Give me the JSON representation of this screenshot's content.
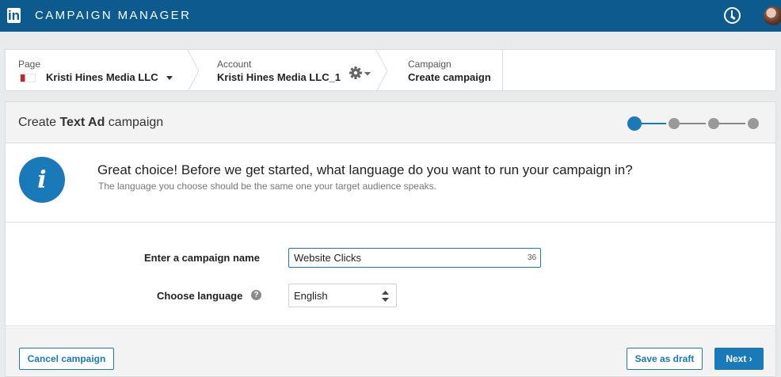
{
  "topbar": {
    "logo_text": "in",
    "app_title": "CAMPAIGN MANAGER",
    "icons": [
      "linkedin-logo",
      "clock-icon",
      "avatar"
    ]
  },
  "breadcrumb": {
    "page": {
      "label": "Page",
      "value": "Kristi Hines Media LLC"
    },
    "account": {
      "label": "Account",
      "value": "Kristi Hines Media LLC_1"
    },
    "campaign": {
      "label": "Campaign",
      "value": "Create campaign"
    }
  },
  "card": {
    "title_prefix": "Create ",
    "title_bold": "Text Ad",
    "title_suffix": " campaign",
    "stepper": {
      "total_steps": 4,
      "current_step": 1
    }
  },
  "info": {
    "icon_glyph": "i",
    "heading": "Great choice! Before we get started, what language do you want to run your campaign in?",
    "subtext": "The language you choose should be the same one your target audience speaks."
  },
  "form": {
    "name_label": "Enter a campaign name",
    "name_value": "Website Clicks",
    "name_remaining": "36",
    "language_label": "Choose language",
    "help_glyph": "?",
    "language_value": "English"
  },
  "footer": {
    "cancel_label": "Cancel campaign",
    "draft_label": "Save as draft",
    "next_label": "Next ›"
  },
  "colors": {
    "topbar": "#0c5a8e",
    "accent": "#1a7ab9",
    "inactive_step": "#999999"
  }
}
